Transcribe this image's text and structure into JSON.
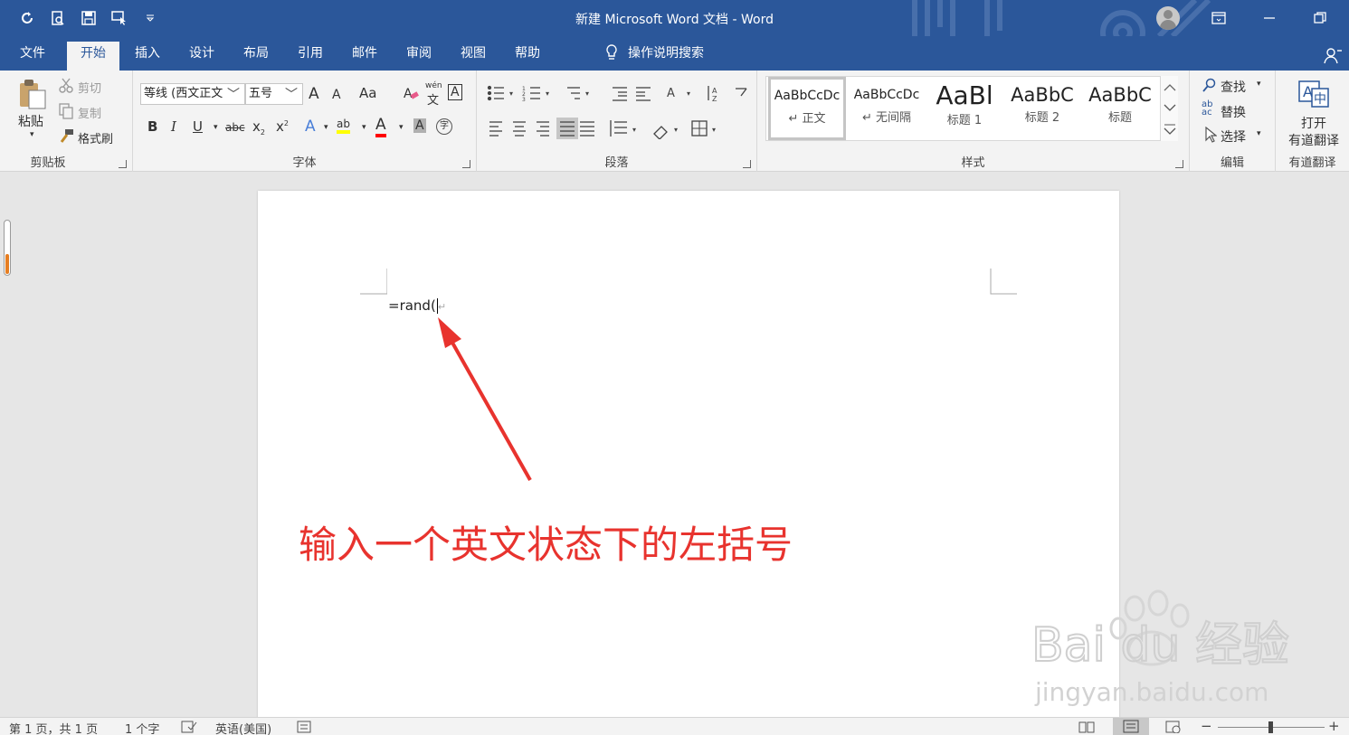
{
  "titlebar": {
    "title": "新建 Microsoft Word 文档  -  Word",
    "qat": [
      "refresh-icon",
      "print-preview-icon",
      "save-icon",
      "touch-mode-icon",
      "customize-qat-icon"
    ],
    "window_buttons": [
      "ribbon-display-icon",
      "minimize-icon",
      "restore-icon"
    ]
  },
  "tabs": [
    "文件",
    "开始",
    "插入",
    "设计",
    "布局",
    "引用",
    "邮件",
    "审阅",
    "视图",
    "帮助"
  ],
  "active_tab": "开始",
  "tell_me": "操作说明搜索",
  "clipboard": {
    "paste": "粘贴",
    "cut": "剪切",
    "copy": "复制",
    "format_painter": "格式刷",
    "label": "剪贴板"
  },
  "font": {
    "font_name": "等线 (西文正文",
    "font_size": "五号",
    "grow": "A",
    "shrink": "A",
    "change_case": "Aa",
    "phonetic": "wén",
    "phonetic_char": "文",
    "char_border": "A",
    "bold": "B",
    "italic": "I",
    "underline": "U",
    "strike": "abc",
    "subscript": "x",
    "superscript": "x",
    "text_effects": "A",
    "highlight": "ab",
    "font_color": "A",
    "char_shading": "A",
    "enclose": "字",
    "label": "字体"
  },
  "paragraph": {
    "label": "段落"
  },
  "styles": {
    "items": [
      {
        "sample": "AaBbCcDc",
        "name": "↵ 正文"
      },
      {
        "sample": "AaBbCcDc",
        "name": "↵ 无间隔"
      },
      {
        "sample": "AaBl",
        "name": "标题 1"
      },
      {
        "sample": "AaBbC",
        "name": "标题 2"
      },
      {
        "sample": "AaBbC",
        "name": "标题"
      }
    ],
    "label": "样式"
  },
  "editing": {
    "find": "查找",
    "replace": "替换",
    "select": "选择",
    "label": "编辑"
  },
  "youdao": {
    "open_line1": "打开",
    "open_line2": "有道翻译",
    "label": "有道翻译"
  },
  "document": {
    "text": "=rand(",
    "annotation": "输入一个英文状态下的左括号"
  },
  "watermark": {
    "brand": "Bai du 经验",
    "url": "jingyan.baidu.com"
  },
  "status": {
    "page": "第 1 页，共 1 页",
    "words": "1 个字",
    "language": "英语(美国)",
    "zoom_minus": "−",
    "zoom_plus": "+"
  },
  "colors": {
    "brand_blue": "#2b579a",
    "annotation_red": "#e8332e",
    "highlight_yellow": "#ffff00",
    "font_red": "#ff0000"
  }
}
